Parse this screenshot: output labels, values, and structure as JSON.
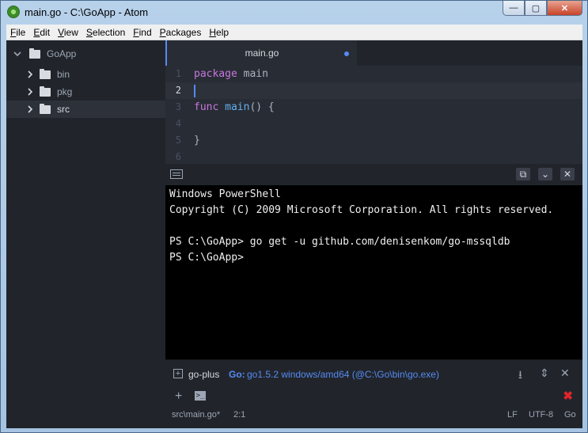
{
  "window": {
    "title": "main.go - C:\\GoApp - Atom",
    "minimize": "—",
    "maximize": "▢",
    "close": "✕"
  },
  "menu": [
    "File",
    "Edit",
    "View",
    "Selection",
    "Find",
    "Packages",
    "Help"
  ],
  "tree": {
    "root": "GoApp",
    "items": [
      "bin",
      "pkg",
      "src"
    ],
    "selected": "src"
  },
  "editor": {
    "tab_title": "main.go",
    "modified": true,
    "line_numbers": [
      "1",
      "2",
      "3",
      "4",
      "5",
      "6"
    ],
    "cursor_line": 2
  },
  "code": {
    "l1_kw": "package",
    "l1_rest": " main",
    "l3_kw": "func",
    "l3_fn": "main",
    "l3_rest": "() {",
    "l5": "}"
  },
  "terminal": {
    "lines": [
      "Windows PowerShell",
      "Copyright (C) 2009 Microsoft Corporation. All rights reserved.",
      "",
      "PS C:\\GoApp> go get -u github.com/denisenkom/go-mssqldb",
      "PS C:\\GoApp>"
    ]
  },
  "goplus": {
    "name": "go-plus",
    "go_label": "Go:",
    "version": "go1.5.2 windows/amd64 (@C:\\Go\\bin\\go.exe)"
  },
  "status": {
    "file": "src\\main.go*",
    "position": "2:1",
    "line_ending": "LF",
    "encoding": "UTF-8",
    "grammar": "Go"
  },
  "icons": {
    "app": "atom-icon",
    "folder": "folder-icon",
    "terminal": "terminal-icon"
  },
  "colors": {
    "accent": "#568af2",
    "keyword": "#c678dd",
    "function": "#61afef",
    "error": "#e0252b"
  }
}
